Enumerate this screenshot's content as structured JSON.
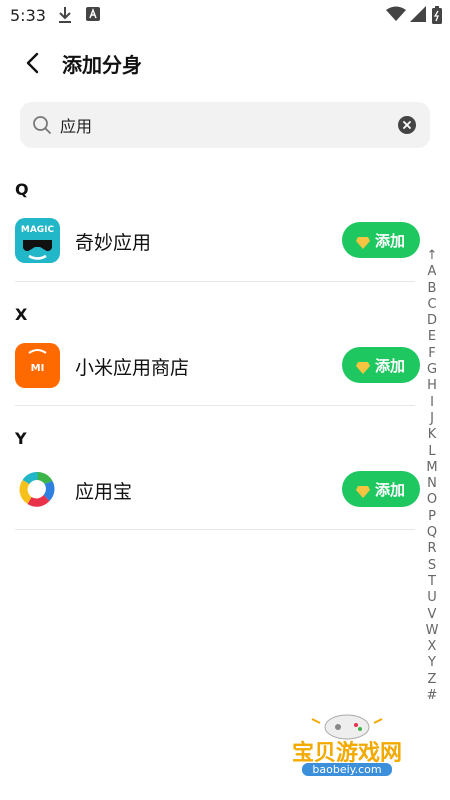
{
  "status_bar": {
    "time": "5:33",
    "icons": [
      "download-icon",
      "a-icon",
      "wifi-icon",
      "signal-icon",
      "battery-icon"
    ]
  },
  "header": {
    "title": "添加分身"
  },
  "search": {
    "value": "应用",
    "icon": "search-icon"
  },
  "sections": [
    {
      "letter": "Q",
      "apps": [
        {
          "name": "奇妙应用",
          "icon": "magic-app-icon",
          "add_label": "添加"
        }
      ]
    },
    {
      "letter": "X",
      "apps": [
        {
          "name": "小米应用商店",
          "icon": "mi-store-icon",
          "add_label": "添加"
        }
      ]
    },
    {
      "letter": "Y",
      "apps": [
        {
          "name": "应用宝",
          "icon": "yingyongbao-icon",
          "add_label": "添加"
        }
      ]
    }
  ],
  "icon_texts": {
    "magic": "MAGIC",
    "mi": "MI"
  },
  "index_bar": [
    "↑",
    "A",
    "B",
    "C",
    "D",
    "E",
    "F",
    "G",
    "H",
    "I",
    "J",
    "K",
    "L",
    "M",
    "N",
    "O",
    "P",
    "Q",
    "R",
    "S",
    "T",
    "U",
    "V",
    "W",
    "X",
    "Y",
    "Z",
    "#"
  ],
  "watermark": {
    "text": "宝贝游戏网",
    "url": "baobeiy.com"
  },
  "colors": {
    "accent": "#1ec760",
    "gem": "#f5c542"
  }
}
